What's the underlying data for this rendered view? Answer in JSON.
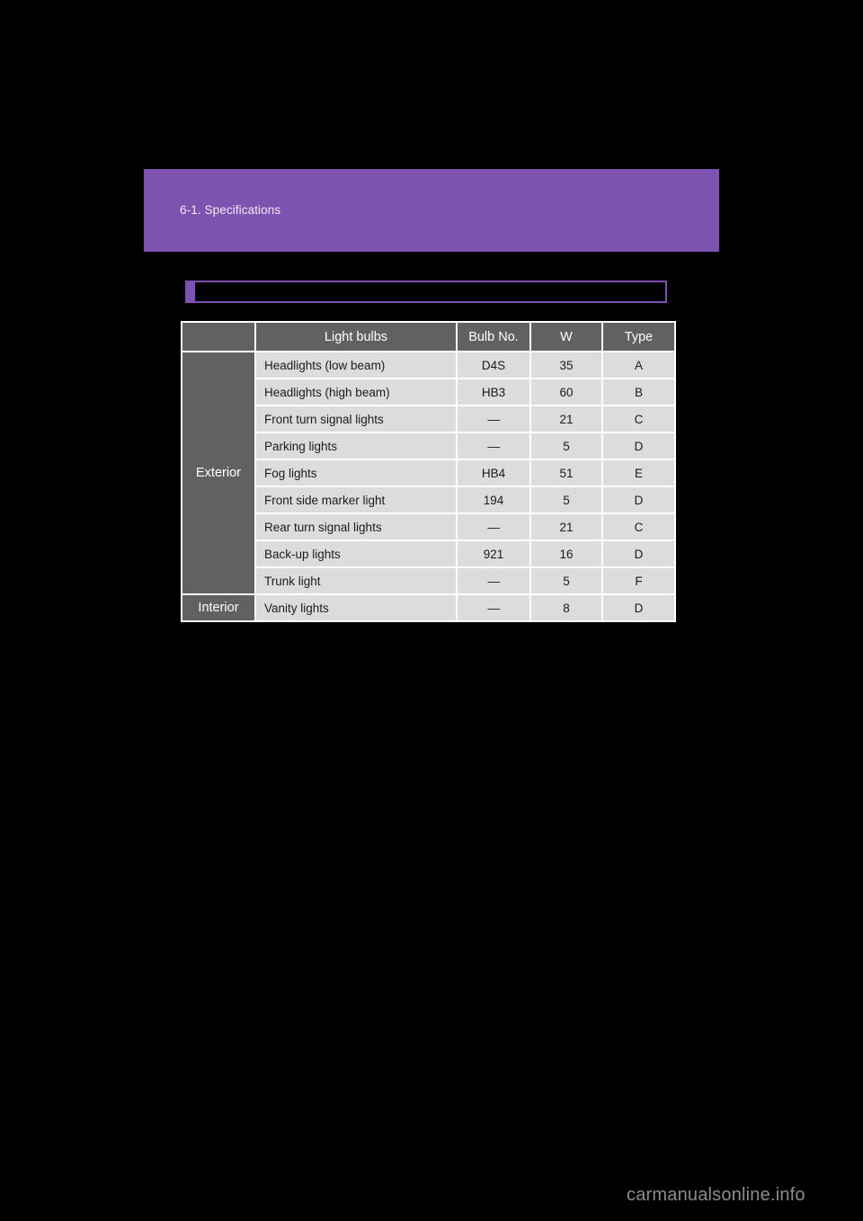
{
  "page": {
    "chapter_label": "6-1. Specifications",
    "section_title": "",
    "watermark": "carmanualsonline.info",
    "colors": {
      "page_background": "#000000",
      "chapter_band": "#7e52b0",
      "title_border": "#7e4fb0",
      "table_header_gray": "#616161",
      "table_cell_gray": "#dcdcdc",
      "table_grid": "#ffffff",
      "watermark": "#8c8c8c"
    }
  },
  "table": {
    "headers": {
      "group": "",
      "name": "Light bulbs",
      "bulb_no": "Bulb No.",
      "watt": "W",
      "type": "Type"
    },
    "groups": [
      {
        "label": "Exterior",
        "rows": [
          {
            "name": "Headlights (low beam)",
            "bulb_no": "D4S",
            "watt": "35",
            "type": "A"
          },
          {
            "name": "Headlights (high beam)",
            "bulb_no": "HB3",
            "watt": "60",
            "type": "B"
          },
          {
            "name": "Front turn signal lights",
            "bulb_no": "—",
            "watt": "21",
            "type": "C"
          },
          {
            "name": "Parking lights",
            "bulb_no": "—",
            "watt": "5",
            "type": "D"
          },
          {
            "name": "Fog lights",
            "bulb_no": "HB4",
            "watt": "51",
            "type": "E"
          },
          {
            "name": "Front side marker light",
            "bulb_no": "194",
            "watt": "5",
            "type": "D"
          },
          {
            "name": "Rear turn signal lights",
            "bulb_no": "—",
            "watt": "21",
            "type": "C"
          },
          {
            "name": "Back-up lights",
            "bulb_no": "921",
            "watt": "16",
            "type": "D"
          },
          {
            "name": "Trunk light",
            "bulb_no": "—",
            "watt": "5",
            "type": "F"
          }
        ]
      },
      {
        "label": "Interior",
        "rows": [
          {
            "name": "Vanity lights",
            "bulb_no": "—",
            "watt": "8",
            "type": "D"
          }
        ]
      }
    ]
  }
}
